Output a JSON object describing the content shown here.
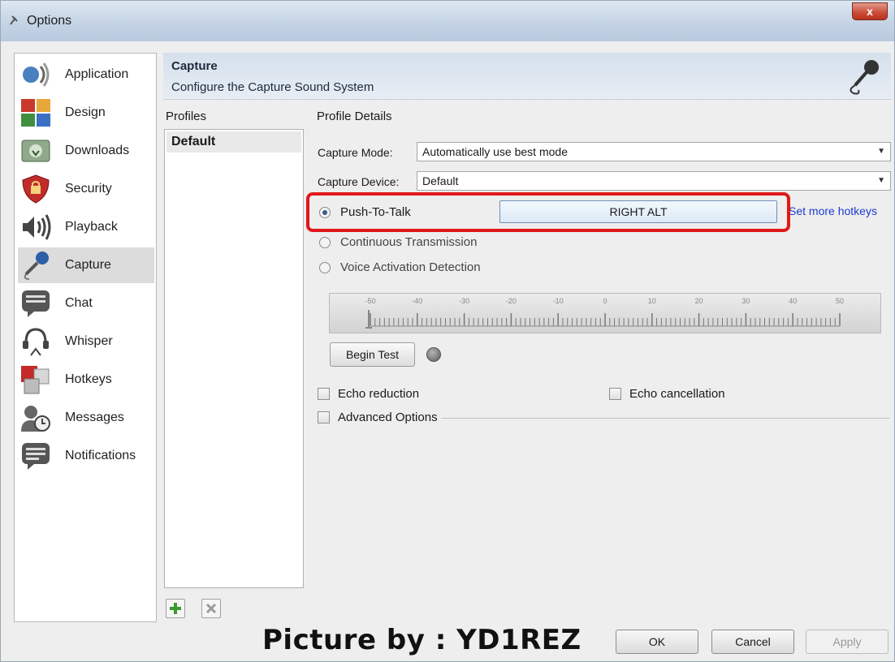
{
  "window": {
    "title": "Options",
    "close_label": "x"
  },
  "sidebar": {
    "items": [
      {
        "label": "Application",
        "icon": "speaker-icon"
      },
      {
        "label": "Design",
        "icon": "design-icon"
      },
      {
        "label": "Downloads",
        "icon": "downloads-icon"
      },
      {
        "label": "Security",
        "icon": "security-icon"
      },
      {
        "label": "Playback",
        "icon": "playback-icon"
      },
      {
        "label": "Capture",
        "icon": "microphone-icon",
        "selected": true
      },
      {
        "label": "Chat",
        "icon": "chat-icon"
      },
      {
        "label": "Whisper",
        "icon": "headset-icon"
      },
      {
        "label": "Hotkeys",
        "icon": "hotkeys-icon"
      },
      {
        "label": "Messages",
        "icon": "messages-icon"
      },
      {
        "label": "Notifications",
        "icon": "notifications-icon"
      }
    ]
  },
  "header": {
    "title": "Capture",
    "subtitle": "Configure the Capture Sound System"
  },
  "profiles": {
    "label": "Profiles",
    "items": [
      "Default"
    ]
  },
  "details": {
    "label": "Profile Details",
    "capture_mode_label": "Capture Mode:",
    "capture_mode_value": "Automatically use best mode",
    "capture_device_label": "Capture Device:",
    "capture_device_value": "Default",
    "push_to_talk_label": "Push-To-Talk",
    "hotkey_value": "RIGHT ALT",
    "more_hotkeys_link": "Set more hotkeys",
    "continuous_label": "Continuous Transmission",
    "vad_label": "Voice Activation Detection",
    "meter_ticks": [
      "-50",
      "-40",
      "-30",
      "-20",
      "-10",
      "0",
      "10",
      "20",
      "30",
      "40",
      "50"
    ],
    "begin_test_label": "Begin Test",
    "echo_reduction_label": "Echo reduction",
    "echo_cancellation_label": "Echo cancellation",
    "advanced_options_label": "Advanced Options"
  },
  "footer": {
    "watermark": "Picture by : YD1REZ",
    "ok_label": "OK",
    "cancel_label": "Cancel",
    "apply_label": "Apply"
  }
}
